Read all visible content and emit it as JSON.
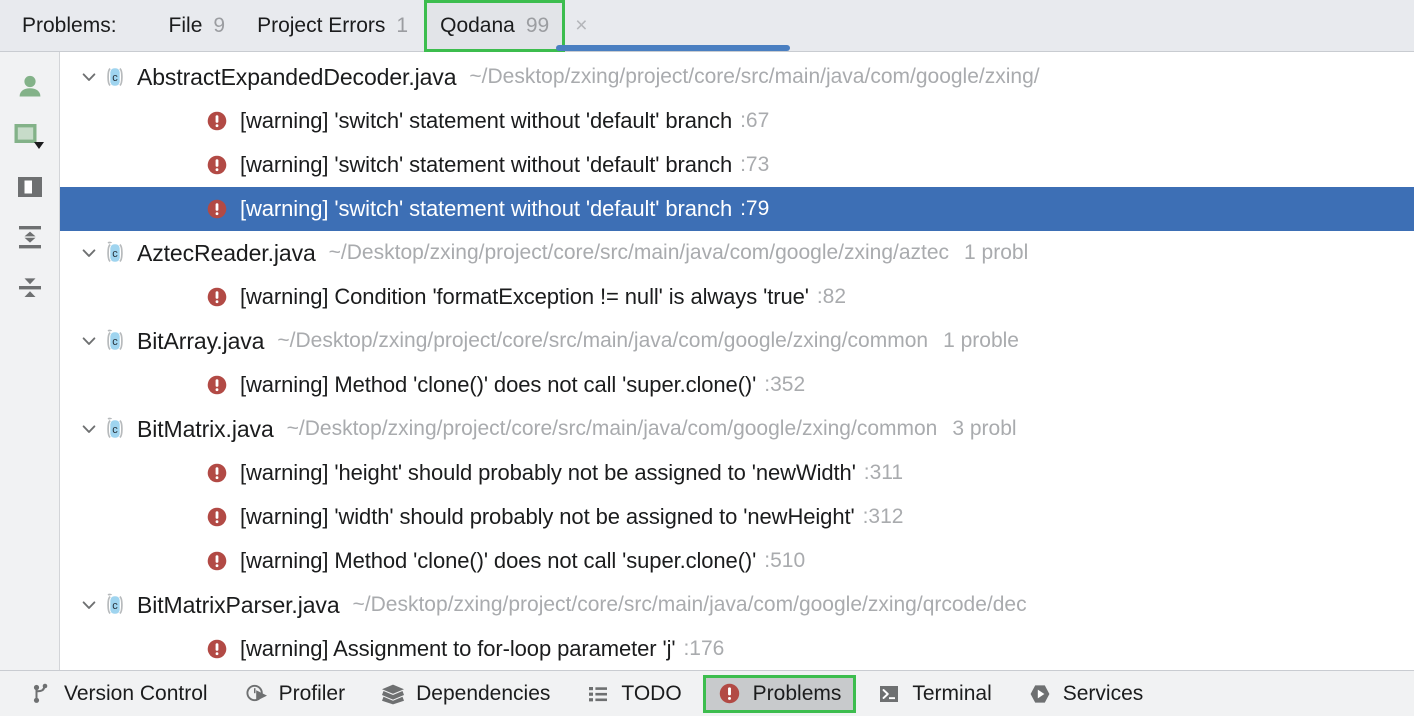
{
  "header": {
    "label": "Problems:",
    "tabs": [
      {
        "name": "File",
        "count": "9",
        "selected": false
      },
      {
        "name": "Project Errors",
        "count": "1",
        "selected": false
      },
      {
        "name": "Qodana",
        "count": "99",
        "selected": true
      }
    ],
    "close_label": "×",
    "selected_tab_accent": "#3cbd4e",
    "underline_color": "#4a7fc1"
  },
  "left_toolbar": {
    "items": [
      {
        "icon": "user-filter-icon",
        "label": "Filter by user"
      },
      {
        "icon": "preview-panel-icon",
        "label": "Preview panel"
      },
      {
        "icon": "split-layout-icon",
        "label": "Split layout"
      },
      {
        "icon": "expand-all-icon",
        "label": "Expand all"
      },
      {
        "icon": "collapse-all-icon",
        "label": "Collapse all"
      }
    ]
  },
  "tree": {
    "selection_color": "#3d6fb5",
    "rows": [
      {
        "kind": "file",
        "name": "AbstractExpandedDecoder.java",
        "path": "~/Desktop/zxing/project/core/src/main/java/com/google/zxing/",
        "count": "",
        "expanded": true
      },
      {
        "kind": "problem",
        "text": "[warning] 'switch' statement without 'default' branch",
        "line": ":67",
        "selected": false
      },
      {
        "kind": "problem",
        "text": "[warning] 'switch' statement without 'default' branch",
        "line": ":73",
        "selected": false
      },
      {
        "kind": "problem",
        "text": "[warning] 'switch' statement without 'default' branch",
        "line": ":79",
        "selected": true
      },
      {
        "kind": "file",
        "name": "AztecReader.java",
        "path": "~/Desktop/zxing/project/core/src/main/java/com/google/zxing/aztec",
        "count": "1 probl",
        "expanded": true
      },
      {
        "kind": "problem",
        "text": "[warning] Condition 'formatException != null' is always 'true'",
        "line": ":82",
        "selected": false
      },
      {
        "kind": "file",
        "name": "BitArray.java",
        "path": "~/Desktop/zxing/project/core/src/main/java/com/google/zxing/common",
        "count": "1 proble",
        "expanded": true
      },
      {
        "kind": "problem",
        "text": "[warning] Method 'clone()' does not call 'super.clone()'",
        "line": ":352",
        "selected": false
      },
      {
        "kind": "file",
        "name": "BitMatrix.java",
        "path": "~/Desktop/zxing/project/core/src/main/java/com/google/zxing/common",
        "count": "3 probl",
        "expanded": true
      },
      {
        "kind": "problem",
        "text": "[warning] 'height' should probably not be assigned to 'newWidth'",
        "line": ":311",
        "selected": false
      },
      {
        "kind": "problem",
        "text": "[warning] 'width' should probably not be assigned to 'newHeight'",
        "line": ":312",
        "selected": false
      },
      {
        "kind": "problem",
        "text": "[warning] Method 'clone()' does not call 'super.clone()'",
        "line": ":510",
        "selected": false
      },
      {
        "kind": "file",
        "name": "BitMatrixParser.java",
        "path": "~/Desktop/zxing/project/core/src/main/java/com/google/zxing/qrcode/dec",
        "count": "",
        "expanded": true
      },
      {
        "kind": "problem",
        "text": "[warning] Assignment to for-loop parameter 'j'",
        "line": ":176",
        "selected": false
      }
    ]
  },
  "statusbar": {
    "items": [
      {
        "label": "Version Control",
        "icon": "branch-icon",
        "active": false
      },
      {
        "label": "Profiler",
        "icon": "profiler-icon",
        "active": false
      },
      {
        "label": "Dependencies",
        "icon": "layers-icon",
        "active": false
      },
      {
        "label": "TODO",
        "icon": "list-icon",
        "active": false
      },
      {
        "label": "Problems",
        "icon": "error-icon",
        "active": true
      },
      {
        "label": "Terminal",
        "icon": "terminal-icon",
        "active": false
      },
      {
        "label": "Services",
        "icon": "services-icon",
        "active": false
      }
    ],
    "active_accent": "#3cbd4e"
  }
}
